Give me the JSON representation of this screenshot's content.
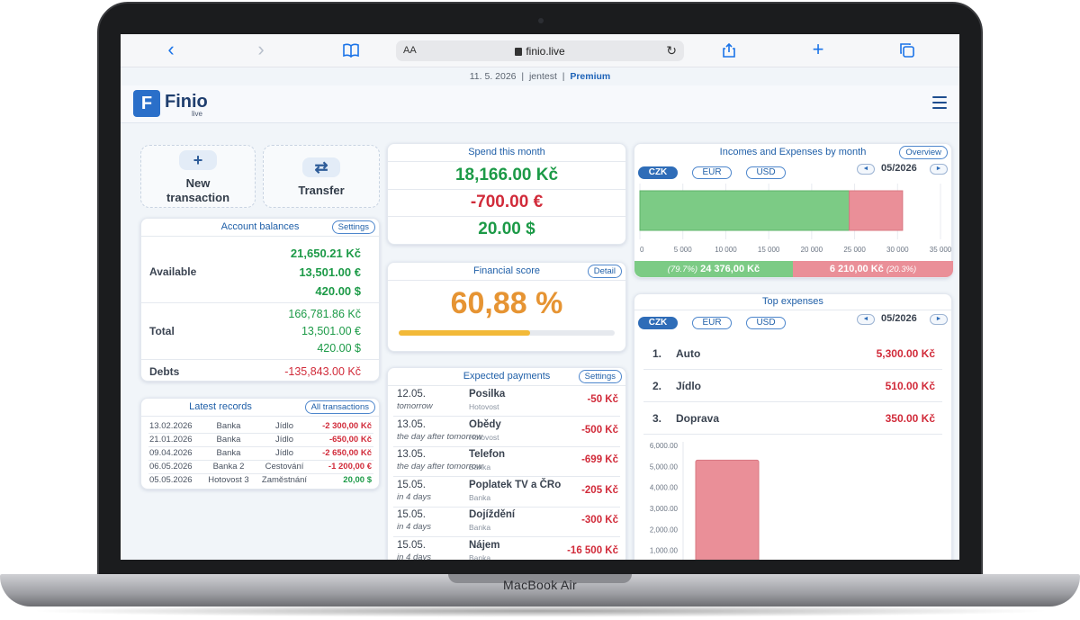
{
  "device": {
    "brand": "MacBook Air"
  },
  "browser": {
    "text_size_label": "AA",
    "url": "finio.live",
    "back_icon": "chevron-left-icon",
    "forward_icon": "chevron-right-icon",
    "bookmarks_icon": "book-icon",
    "reload_icon": "reload-icon",
    "share_icon": "share-icon",
    "new_tab_icon": "plus-icon",
    "tabs_icon": "tabs-icon"
  },
  "info": {
    "date": "11. 5. 2026",
    "sep1": "|",
    "user": "jentest",
    "sep2": "|",
    "plan": "Premium"
  },
  "app": {
    "logo_letter": "F",
    "name": "Finio",
    "sub": "live"
  },
  "actions": {
    "new_icon": "+",
    "new_label_1": "New",
    "new_label_2": "transaction",
    "transfer_icon": "⇄",
    "transfer_label": "Transfer"
  },
  "account_balances": {
    "title": "Account balances",
    "settings": "Settings",
    "available_label": "Available",
    "available": [
      "21,650.21 Kč",
      "13,501.00 €",
      "420.00 $"
    ],
    "total_label": "Total",
    "total": [
      "166,781.86 Kč",
      "13,501.00 €",
      "420.00 $"
    ],
    "debts_label": "Debts",
    "debts": "-135,843.00 Kč"
  },
  "latest_records": {
    "title": "Latest records",
    "link": "All transactions",
    "rows": [
      {
        "date": "13.02.2026",
        "account": "Banka",
        "category": "Jídlo",
        "amount": "-2 300,00 Kč",
        "type": "expense"
      },
      {
        "date": "21.01.2026",
        "account": "Banka",
        "category": "Jídlo",
        "amount": "-650,00 Kč",
        "type": "expense"
      },
      {
        "date": "09.04.2026",
        "account": "Banka",
        "category": "Jídlo",
        "amount": "-2 650,00 Kč",
        "type": "expense"
      },
      {
        "date": "06.05.2026",
        "account": "Banka 2",
        "category": "Cestování",
        "amount": "-1 200,00 €",
        "type": "expense"
      },
      {
        "date": "05.05.2026",
        "account": "Hotovost 3",
        "category": "Zaměstnání",
        "amount": "20,00 $",
        "type": "income"
      }
    ]
  },
  "spend": {
    "title": "Spend this month",
    "values": [
      {
        "text": "18,166.00  Kč",
        "color": "#1c9a47"
      },
      {
        "text": "-700.00  €",
        "color": "#d12b3a"
      },
      {
        "text": "20.00  $",
        "color": "#1c9a47"
      }
    ]
  },
  "financial_score": {
    "title": "Financial score",
    "detail": "Detail",
    "value": "60,88 %",
    "progress": 0.6088
  },
  "expected_payments": {
    "title": "Expected payments",
    "settings": "Settings",
    "rows": [
      {
        "date": "12.05.",
        "note": "tomorrow",
        "name": "Posilka",
        "account": "Hotovost",
        "amount": "-50 Kč"
      },
      {
        "date": "13.05.",
        "note": "the day after tomorrow",
        "name": "Obědy",
        "account": "Hotovost",
        "amount": "-500 Kč"
      },
      {
        "date": "13.05.",
        "note": "the day after tomorrow",
        "name": "Telefon",
        "account": "Banka",
        "amount": "-699 Kč"
      },
      {
        "date": "15.05.",
        "note": "in 4 days",
        "name": "Poplatek TV a ČRo",
        "account": "Banka",
        "amount": "-205 Kč"
      },
      {
        "date": "15.05.",
        "note": "in 4 days",
        "name": "Dojíždění",
        "account": "Banka",
        "amount": "-300 Kč"
      },
      {
        "date": "15.05.",
        "note": "in 4 days",
        "name": "Nájem",
        "account": "Banka",
        "amount": "-16 500 Kč"
      }
    ]
  },
  "incomes_expenses": {
    "title": "Incomes and Expenses by month",
    "link": "Overview",
    "currencies": [
      "CZK",
      "EUR",
      "USD"
    ],
    "active_currency": "CZK",
    "prev": "◄",
    "next": "►",
    "period": "05/2026",
    "income_label_pct": "(79.7%)",
    "income_label_val": "24 376,00 Kč",
    "expense_label_val": "6 210,00 Kč",
    "expense_label_pct": "(20.3%)"
  },
  "top_expenses": {
    "title": "Top expenses",
    "currencies": [
      "CZK",
      "EUR",
      "USD"
    ],
    "active_currency": "CZK",
    "prev": "◄",
    "next": "►",
    "period": "05/2026",
    "rows": [
      {
        "rank": "1.",
        "name": "Auto",
        "amount": "5,300.00 Kč"
      },
      {
        "rank": "2.",
        "name": "Jídlo",
        "amount": "510.00 Kč"
      },
      {
        "rank": "3.",
        "name": "Doprava",
        "amount": "350.00 Kč"
      }
    ]
  },
  "chart_data": [
    {
      "type": "bar",
      "orientation": "horizontal-stacked",
      "series": [
        {
          "name": "Incomes",
          "values": [
            24376
          ],
          "color": "#7ccb85"
        },
        {
          "name": "Expenses",
          "values": [
            6210
          ],
          "color": "#ea8f98"
        }
      ],
      "xlim": [
        0,
        35000
      ],
      "xticks": [
        "0",
        "5 000",
        "10 000",
        "15 000",
        "20 000",
        "25 000",
        "30 000",
        "35 000"
      ],
      "grid": true
    },
    {
      "type": "bar",
      "categories": [
        "Auto"
      ],
      "values": [
        5300
      ],
      "color": "#ea8f98",
      "ylim": [
        0,
        6000
      ],
      "yticks": [
        "6,000.00",
        "5,000.00",
        "4,000.00",
        "3,000.00",
        "2,000.00",
        "1,000.00"
      ],
      "grid": true
    }
  ]
}
